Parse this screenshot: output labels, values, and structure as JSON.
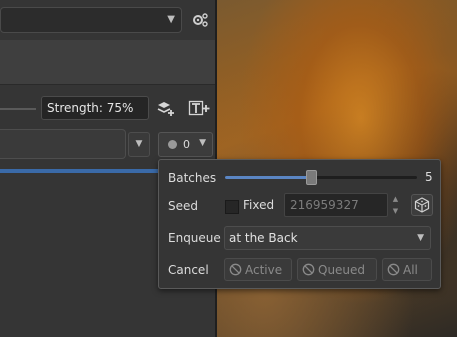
{
  "left_panel": {
    "strength_label": "Strength: 75%"
  },
  "queue": {
    "count": "0"
  },
  "popup": {
    "batches_label": "Batches",
    "batches_value": "5",
    "batches_fraction": 0.45,
    "seed_label": "Seed",
    "fixed_label": "Fixed",
    "seed_value": "216959327",
    "enqueue_label": "Enqueue",
    "enqueue_value": "at the Back",
    "cancel_label": "Cancel",
    "cancel_active": "Active",
    "cancel_queued": "Queued",
    "cancel_all": "All"
  },
  "colors": {
    "accent": "#5b86c4",
    "progress": "#3a6aa8",
    "panel": "#353535"
  },
  "icons": [
    "settings-gear-icon",
    "add-layer-icon",
    "add-text-layer-icon",
    "chevron-down-icon",
    "dice-icon",
    "cancel-icon"
  ]
}
